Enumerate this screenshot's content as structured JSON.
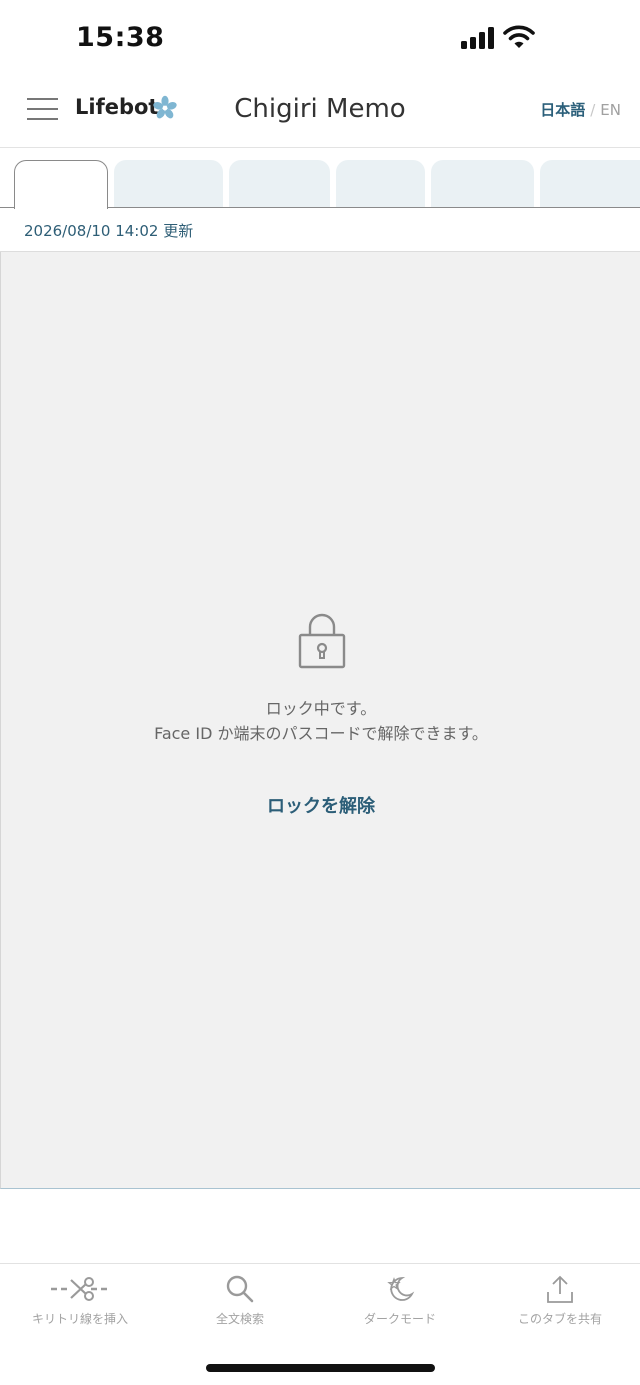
{
  "status_bar": {
    "time": "15:38"
  },
  "header": {
    "brand": "Lifebot",
    "title": "Chigiri Memo",
    "lang_ja": "日本語",
    "lang_separator": "/",
    "lang_en": "EN"
  },
  "tabs": {
    "count": 6,
    "active_index": 0
  },
  "memo": {
    "updated": "2026/08/10 14:02 更新"
  },
  "lock": {
    "message_line1": "ロック中です。",
    "message_line2": "Face ID か端末のパスコードで解除できます。",
    "unlock_label": "ロックを解除"
  },
  "toolbar": {
    "items": [
      {
        "label": "キリトリ線を挿入",
        "icon": "scissors-cut-line-icon"
      },
      {
        "label": "全文検索",
        "icon": "search-icon"
      },
      {
        "label": "ダークモード",
        "icon": "moon-star-icon"
      },
      {
        "label": "このタブを共有",
        "icon": "share-icon"
      }
    ]
  },
  "colors": {
    "accent": "#2c5e78",
    "tab_inactive": "#eaf1f4",
    "locked_background": "#f1f1f1",
    "brand_flower": "#7fb6d2"
  }
}
